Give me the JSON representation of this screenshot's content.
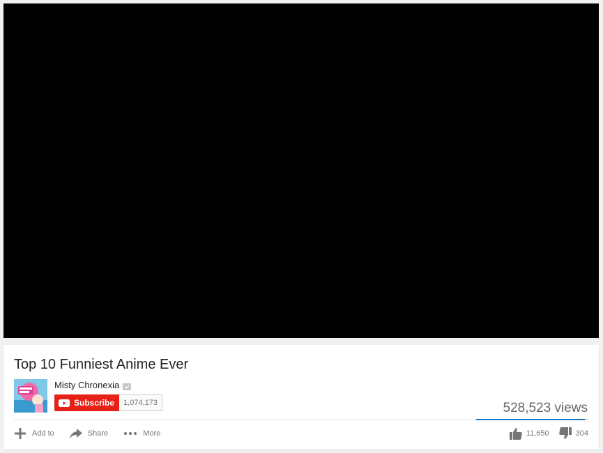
{
  "video": {
    "title": "Top 10 Funniest Anime Ever",
    "views": "528,523 views",
    "likes": "11,650",
    "dislikes": "304",
    "like_ratio": 0.975
  },
  "channel": {
    "name": "Misty Chronexia",
    "avatar_icon": "channel-avatar",
    "verified_icon": "verified-badge-icon"
  },
  "subscribe": {
    "label": "Subscribe",
    "count": "1,074,173",
    "color": "#e62117"
  },
  "actions": {
    "add_to": "Add to",
    "share": "Share",
    "more": "More"
  },
  "colors": {
    "player_bg": "#000000",
    "sentiment_like": "#167ac6",
    "page_bg": "#f1f1f1"
  }
}
